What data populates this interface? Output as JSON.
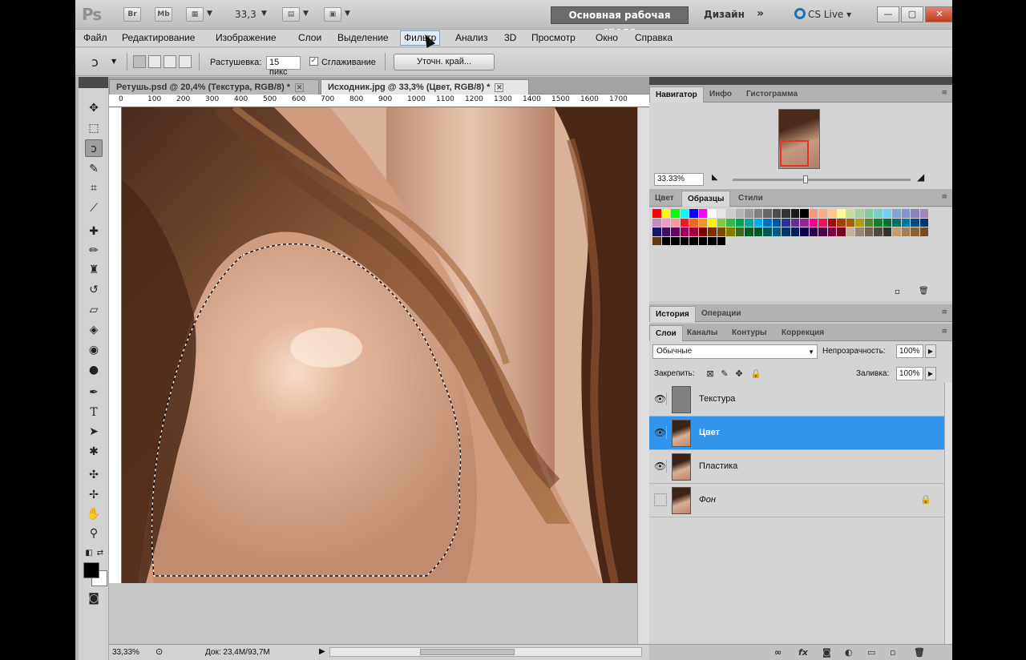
{
  "titlebar": {
    "logo": "Ps",
    "bridge_btn": "Br",
    "minibridge_btn": "Mb",
    "zoom_value": "33,3",
    "workspace_active": "Основная рабочая среда",
    "workspace_design": "Дизайн",
    "more": "»",
    "cs_live": "CS Live"
  },
  "menu": {
    "file": "Файл",
    "edit": "Редактирование",
    "image": "Изображение",
    "layers": "Слои",
    "select": "Выделение",
    "filter": "Фильтр",
    "analysis": "Анализ",
    "threed": "3D",
    "view": "Просмотр",
    "window": "Окно",
    "help": "Справка"
  },
  "options": {
    "feather_label": "Растушевка:",
    "feather_value": "15 пикс",
    "antialias_label": "Сглаживание",
    "antialias_checked": true,
    "refine_edge": "Уточн. край..."
  },
  "document": {
    "tabs": [
      {
        "label": "Ретушь.psd @ 20,4% (Текстура, RGB/8) *"
      },
      {
        "label": "Исходник.jpg @ 33,3% (Цвет, RGB/8) *"
      }
    ],
    "ruler_marks": [
      "0",
      "100",
      "200",
      "300",
      "400",
      "500",
      "600",
      "700",
      "800",
      "900",
      "1000",
      "1100",
      "1200",
      "1300",
      "1400",
      "1500",
      "1600",
      "1700"
    ],
    "status_zoom": "33,33%",
    "status_doc": "Док: 23,4M/93,7M"
  },
  "navigator": {
    "tabs": [
      "Навигатор",
      "Инфо",
      "Гистограмма"
    ],
    "zoom": "33.33%"
  },
  "swatch_panel": {
    "tabs": [
      "Цвет",
      "Образцы",
      "Стили"
    ]
  },
  "history_panel": {
    "tabs": [
      "История",
      "Операции"
    ]
  },
  "layers_panel": {
    "tabs": [
      "Слои",
      "Каналы",
      "Контуры",
      "Коррекция"
    ],
    "blend_mode": "Обычные",
    "opacity_label": "Непрозрачность:",
    "opacity_value": "100%",
    "lock_label": "Закрепить:",
    "fill_label": "Заливка:",
    "fill_value": "100%",
    "layers": [
      {
        "name": "Текстура",
        "visible": true,
        "selected": false
      },
      {
        "name": "Цвет",
        "visible": true,
        "selected": true
      },
      {
        "name": "Пластика",
        "visible": true,
        "selected": false
      },
      {
        "name": "Фон",
        "visible": false,
        "selected": false,
        "locked": true
      }
    ]
  },
  "colors": {
    "selection_blue": "#3394ec",
    "workspace_dark": "#6b6b6b",
    "skin": "#cfa184",
    "hair": "#5a3320",
    "foreground": "#000000",
    "background": "#ffffff"
  },
  "swatch_colors": [
    "#ff0000",
    "#ffff00",
    "#00ff00",
    "#00ffff",
    "#0000ff",
    "#ff00ff",
    "#ffffff",
    "#e5e5e5",
    "#cccccc",
    "#b3b3b3",
    "#999999",
    "#808080",
    "#666666",
    "#4d4d4d",
    "#333333",
    "#1a1a1a",
    "#000000",
    "#f7977a",
    "#fbad82",
    "#fdc68c",
    "#fff799",
    "#c4df9b",
    "#a3d39c",
    "#82ca9c",
    "#7bcdc8",
    "#6ecff6",
    "#7ea7d8",
    "#8493ca",
    "#8882be",
    "#a187be",
    "#bc8dbf",
    "#f49ac2",
    "#f6989d",
    "#ed1c24",
    "#f26522",
    "#f7941d",
    "#fff200",
    "#8dc63f",
    "#39b54a",
    "#00a651",
    "#00a99d",
    "#00aeef",
    "#0072bc",
    "#0054a6",
    "#2e3192",
    "#662d91",
    "#92278f",
    "#ec008c",
    "#ed145b",
    "#9e0b0f",
    "#a0410d",
    "#a36209",
    "#aba000",
    "#598527",
    "#1a7b30",
    "#007236",
    "#00746b",
    "#0076a3",
    "#004b80",
    "#003471",
    "#1b1464",
    "#440e62",
    "#630460",
    "#9e005d",
    "#9e0039",
    "#790000",
    "#7b2e00",
    "#7d4900",
    "#827b00",
    "#406618",
    "#005e20",
    "#005826",
    "#005952",
    "#005b7f",
    "#003663",
    "#002157",
    "#0d004c",
    "#32004b",
    "#4b0049",
    "#7b0046",
    "#7a0026",
    "#c7b299",
    "#998675",
    "#736357",
    "#534741",
    "#37302d",
    "#c69c6d",
    "#a67c52",
    "#8c6239",
    "#754c24",
    "#603913",
    "#000000",
    "#000000",
    "#000000",
    "#000000",
    "#000000",
    "#000000",
    "#000000"
  ]
}
